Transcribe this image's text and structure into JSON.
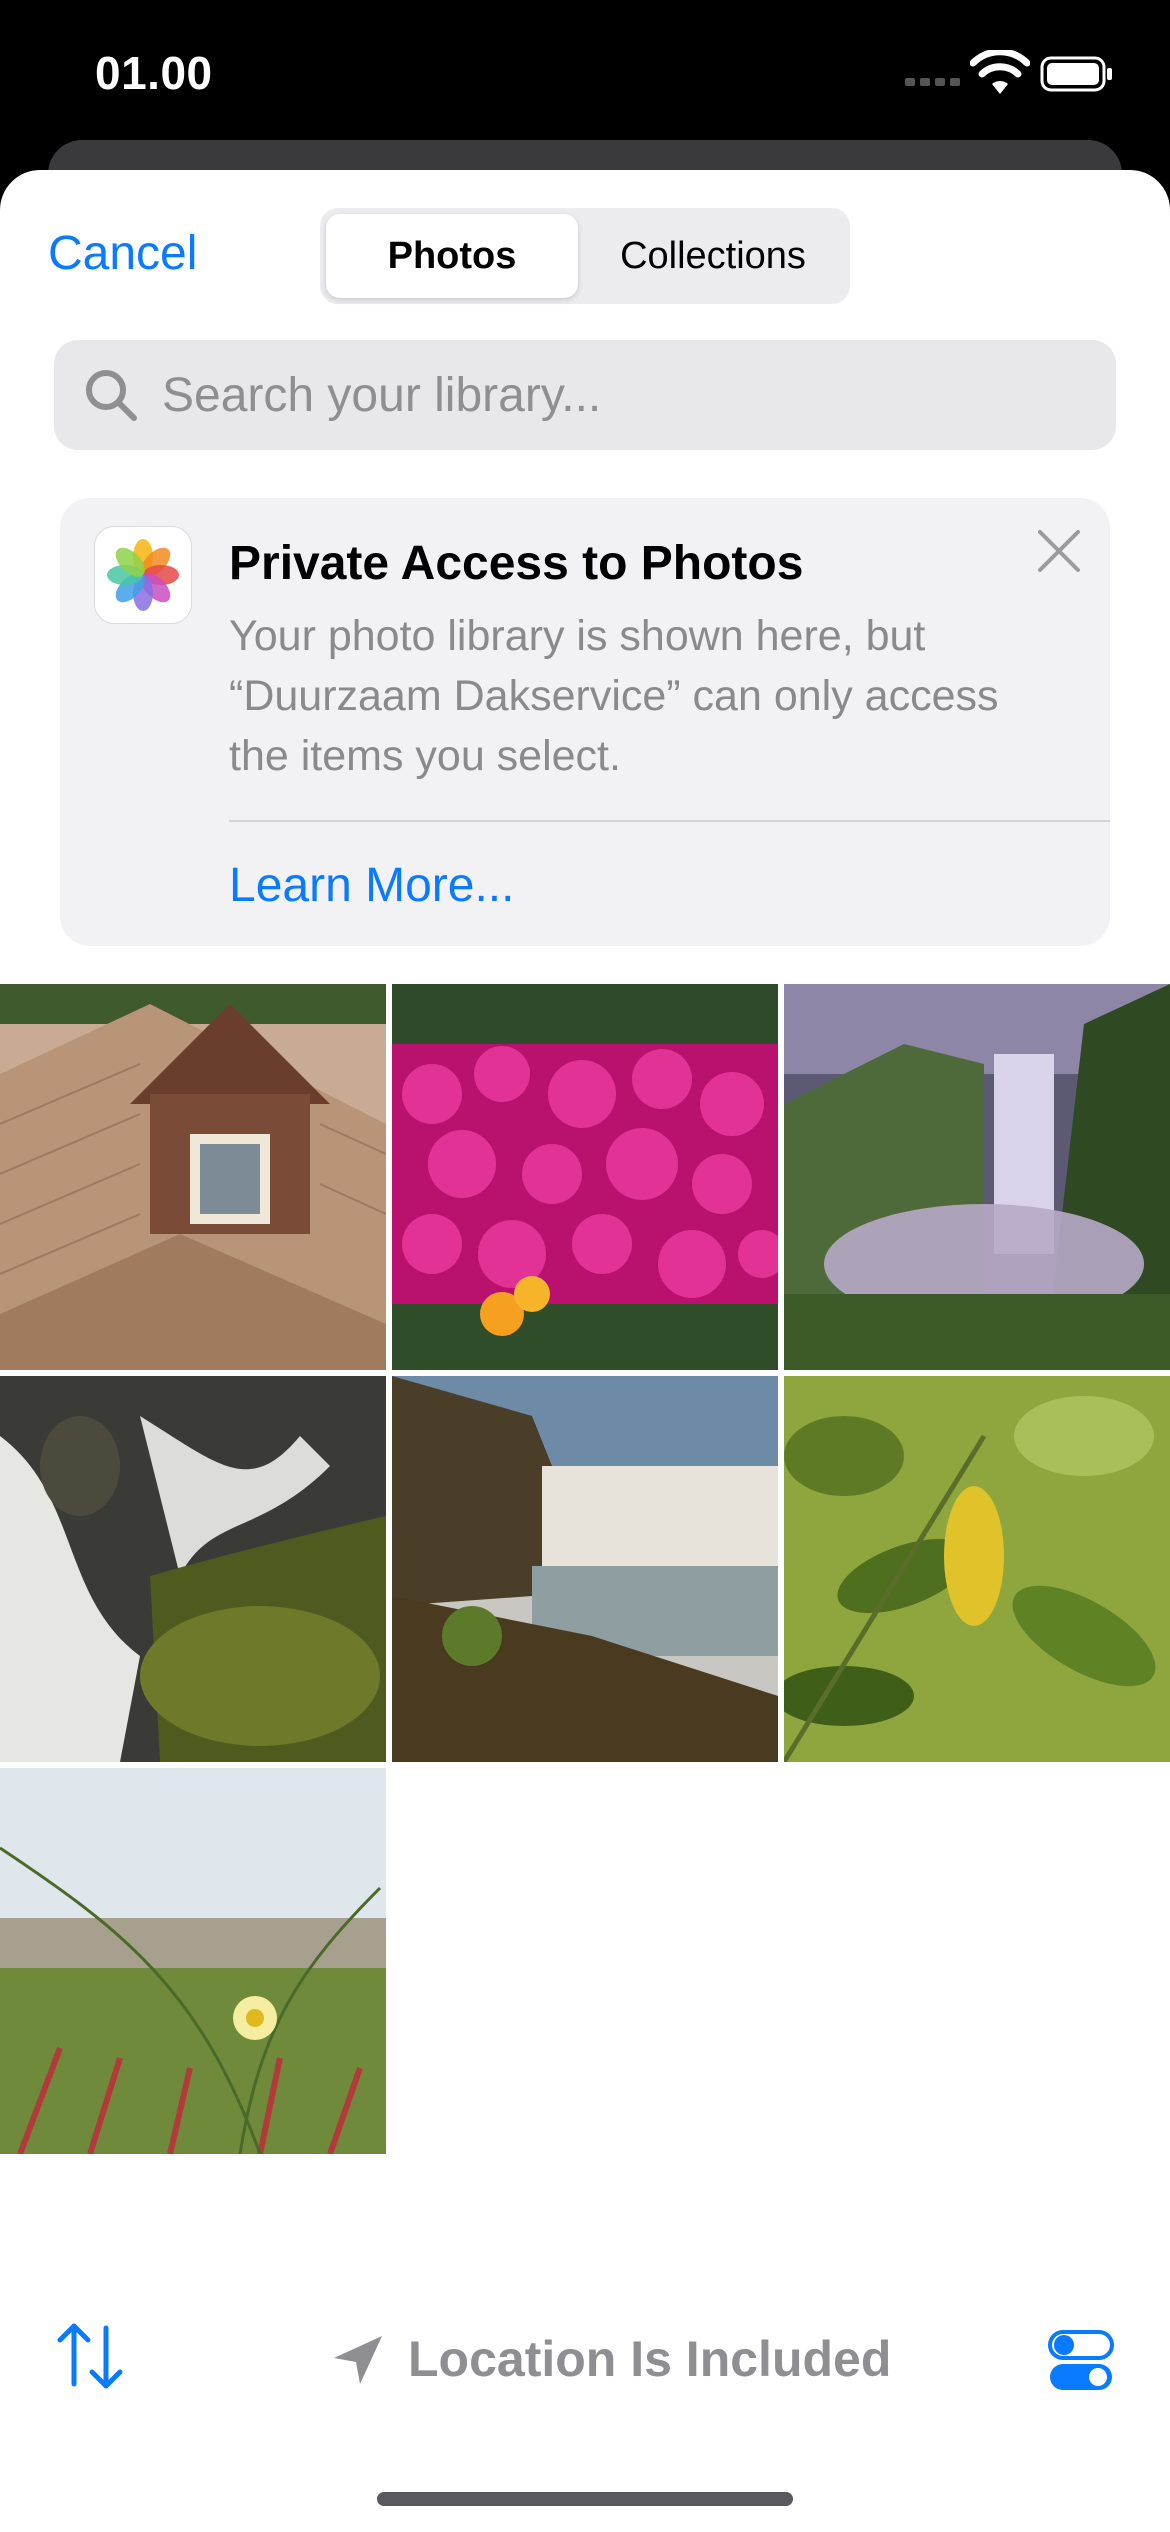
{
  "status_bar": {
    "time": "01.00"
  },
  "header": {
    "cancel_label": "Cancel",
    "tabs": [
      {
        "label": "Photos",
        "selected": true
      },
      {
        "label": "Collections",
        "selected": false
      }
    ]
  },
  "search": {
    "placeholder": "Search your library..."
  },
  "notice": {
    "title": "Private Access to Photos",
    "body": "Your photo library is shown here, but “Duurzaam Dakservice” can only access the items you select.",
    "link_label": "Learn More..."
  },
  "photos": [
    {
      "subject": "roof-dormer"
    },
    {
      "subject": "pink-flowers"
    },
    {
      "subject": "waterfall-valley"
    },
    {
      "subject": "waterfall-rocks"
    },
    {
      "subject": "waterfall-sunset"
    },
    {
      "subject": "green-leaves"
    },
    {
      "subject": "dune-flower"
    }
  ],
  "toolbar": {
    "location_label": "Location Is Included"
  },
  "colors": {
    "accent": "#0a7aff",
    "muted": "#8e8e93"
  }
}
